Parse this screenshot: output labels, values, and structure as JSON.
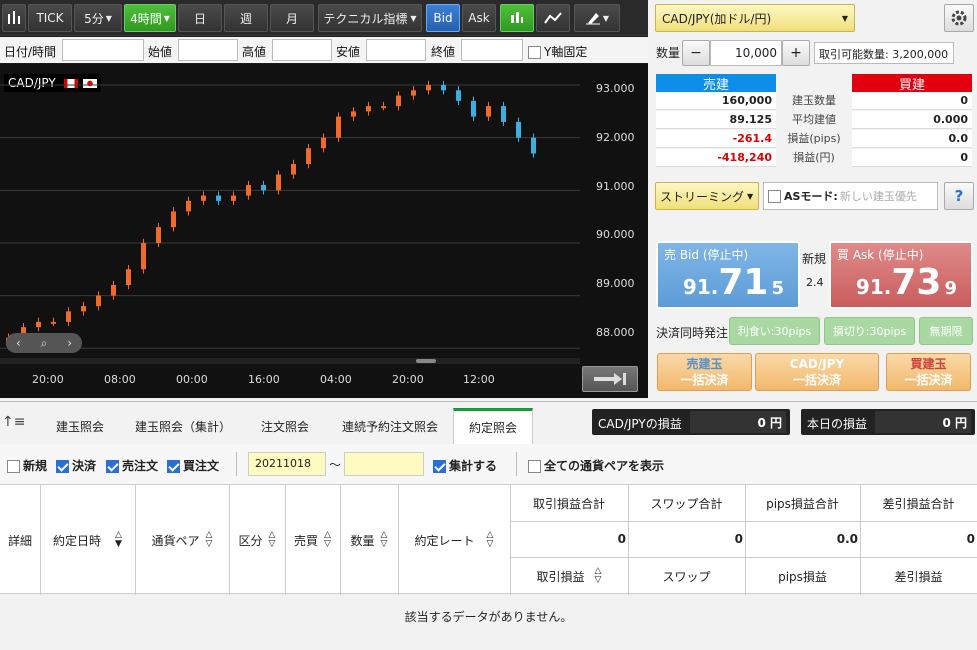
{
  "toolbar": {
    "tick": "TICK",
    "interval_5m": "5分",
    "interval_4h": "4時間",
    "day": "日",
    "week": "週",
    "month": "月",
    "technical": "テクニカル指標",
    "bid": "Bid",
    "ask": "Ask"
  },
  "ohlc": {
    "datetime": "日付/時間",
    "open": "始値",
    "high": "高値",
    "low": "安値",
    "close": "終値",
    "y_fixed": "Y軸固定"
  },
  "chart": {
    "pair": "CAD/JPY",
    "y_ticks": [
      "93.000",
      "92.000",
      "91.000",
      "90.000",
      "89.000",
      "88.000"
    ],
    "x_ticks": [
      "20:00",
      "08:00",
      "00:00",
      "16:00",
      "04:00",
      "20:00",
      "12:00"
    ]
  },
  "chart_data": {
    "type": "candlestick",
    "title": "CAD/JPY",
    "xlabel": "",
    "ylabel": "",
    "ylim": [
      87.7,
      93.4
    ],
    "x_ticks": [
      "20:00",
      "08:00",
      "00:00",
      "16:00",
      "04:00",
      "20:00",
      "12:00"
    ],
    "close_series": [
      88.2,
      88.4,
      88.5,
      88.5,
      88.7,
      88.8,
      89.0,
      89.2,
      89.5,
      90.0,
      90.3,
      90.6,
      90.8,
      90.9,
      90.8,
      90.9,
      91.1,
      91.0,
      91.3,
      91.5,
      91.8,
      92.0,
      92.4,
      92.5,
      92.6,
      92.6,
      92.8,
      92.9,
      93.0,
      92.9,
      92.7,
      92.4,
      92.6,
      92.3,
      92.0,
      91.7
    ]
  },
  "pair_select": "CAD/JPY(加ドル/円)",
  "qty": {
    "label": "数量",
    "minus": "−",
    "plus": "+",
    "value": "10,000",
    "available": "取引可能数量: 3,200,000"
  },
  "positions": {
    "sell_header": "売建",
    "buy_header": "買建",
    "rows": [
      {
        "label": "建玉数量",
        "sell": "160,000",
        "buy": "0"
      },
      {
        "label": "平均建値",
        "sell": "89.125",
        "buy": "0.000"
      },
      {
        "label": "損益(pips)",
        "sell": "-261.4",
        "buy": "0.0"
      },
      {
        "label": "損益(円)",
        "sell": "-418,240",
        "buy": "0"
      }
    ]
  },
  "streaming": "ストリーミング",
  "as_mode": {
    "label": "ASモード:",
    "placeholder": "新しい建玉優先"
  },
  "help": "?",
  "sell_price": {
    "label": "売 Bid (停止中)",
    "big": "91.",
    "large": "71",
    "small": "5"
  },
  "buy_price": {
    "label": "買 Ask (停止中)",
    "big": "91.",
    "large": "73",
    "small": "9"
  },
  "new_label": "新規",
  "spread": "2.4",
  "settle": {
    "label": "決済同時発注",
    "take_profit": "利食い:30pips",
    "stop_loss": "損切り:30pips",
    "unlimited": "無期限"
  },
  "bulk": {
    "sell_line1": "売建玉",
    "sell_line2": "一括決済",
    "pair_line1": "CAD/JPY",
    "pair_line2": "一括決済",
    "buy_line1": "買建玉",
    "buy_line2": "一括決済"
  },
  "tabs": [
    "建玉照会",
    "建玉照会（集計）",
    "注文照会",
    "連続予約注文照会",
    "約定照会"
  ],
  "pnl": {
    "pair_label": "CAD/JPYの損益",
    "pair_value": "0",
    "today_label": "本日の損益",
    "today_value": "0",
    "unit": "円"
  },
  "filters": {
    "new": "新規",
    "settle": "決済",
    "sell": "売注文",
    "buy": "買注文",
    "date_from": "20211018",
    "tilde": "〜",
    "aggregate": "集計する",
    "all_pairs": "全ての通貨ペアを表示"
  },
  "table": {
    "cols": [
      "詳細",
      "約定日時",
      "通貨ペア",
      "区分",
      "売買",
      "数量",
      "約定レート"
    ],
    "sum_headers": [
      "取引損益合計",
      "スワップ合計",
      "pips損益合計",
      "差引損益合計"
    ],
    "sum_values": [
      "0",
      "0",
      "0.0",
      "0"
    ],
    "sub_headers": [
      "取引損益",
      "スワップ",
      "pips損益",
      "差引損益"
    ],
    "empty": "該当するデータがありません。"
  }
}
